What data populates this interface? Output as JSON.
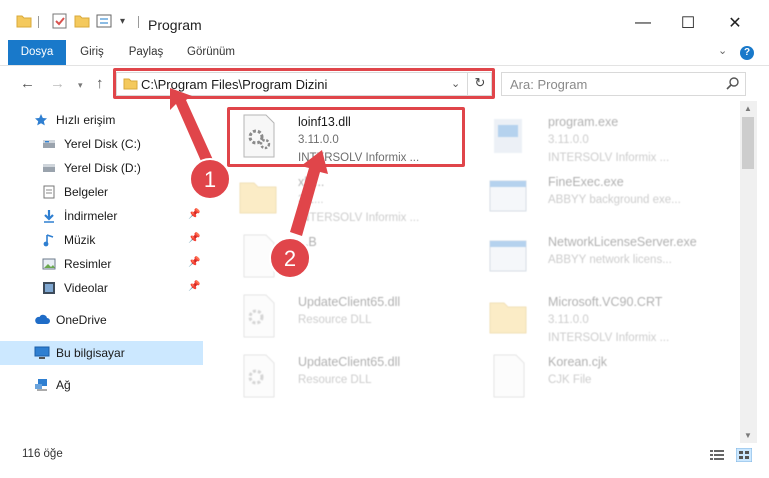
{
  "window": {
    "title": "Program",
    "minimize_glyph": "—",
    "maximize_glyph": "☐",
    "close_glyph": "✕"
  },
  "ribbon": {
    "tabs": [
      "Dosya",
      "Giriş",
      "Paylaş",
      "Görünüm"
    ],
    "help_label": "?"
  },
  "nav": {
    "address": "C:\\Program Files\\Program Dizini",
    "search_placeholder": "Ara: Program"
  },
  "sidebar": {
    "items": [
      {
        "label": "Hızlı erişim",
        "icon": "star-icon"
      },
      {
        "label": "Yerel Disk (C:)",
        "icon": "drive-icon"
      },
      {
        "label": "Yerel Disk (D:)",
        "icon": "drive-icon"
      },
      {
        "label": "Belgeler",
        "icon": "documents-icon"
      },
      {
        "label": "İndirmeler",
        "icon": "downloads-icon"
      },
      {
        "label": "Müzik",
        "icon": "music-icon"
      },
      {
        "label": "Resimler",
        "icon": "pictures-icon"
      },
      {
        "label": "Videolar",
        "icon": "videos-icon"
      },
      {
        "label": "OneDrive",
        "icon": "cloud-icon"
      },
      {
        "label": "Bu bilgisayar",
        "icon": "computer-icon"
      },
      {
        "label": "Ağ",
        "icon": "network-icon"
      }
    ]
  },
  "files": [
    {
      "name": "loinf13.dll",
      "version": "3.11.0.0",
      "description": "INTERSOLV Informix ...",
      "icon": "dll-gear-icon"
    },
    {
      "name": "program.exe",
      "version": "3.11.0.0",
      "description": "INTERSOLV Informix ...",
      "icon": "exe-icon"
    },
    {
      "name": "xl4...",
      "version": "3.1...",
      "description": "INTERSOLV Informix ...",
      "icon": "folder-icon"
    },
    {
      "name": "FineExec.exe",
      "version": "ABBYY background exe...",
      "description": "",
      "icon": "app-window-icon"
    },
    {
      "name": "...B",
      "version": "...",
      "description": "",
      "icon": "file-icon"
    },
    {
      "name": "NetworkLicenseServer.exe",
      "version": "ABBYY network licens...",
      "description": "",
      "icon": "app-window-icon"
    },
    {
      "name": "UpdateClient65.dll",
      "version": "Resource DLL",
      "description": "",
      "icon": "dll-gear-icon"
    },
    {
      "name": "Microsoft.VC90.CRT",
      "version": "3.11.0.0",
      "description": "INTERSOLV Informix ...",
      "icon": "folder-icon"
    },
    {
      "name": "UpdateClient65.dll",
      "version": "Resource DLL",
      "description": "",
      "icon": "dll-gear-icon"
    },
    {
      "name": "Korean.cjk",
      "version": "CJK File",
      "description": "",
      "icon": "file-icon"
    }
  ],
  "status": {
    "item_count": "116 öğe"
  },
  "annotations": {
    "step1": "1",
    "step2": "2",
    "highlight_color": "#e0454a"
  },
  "colors": {
    "accent": "#1979ca",
    "selection": "#cce8ff"
  }
}
